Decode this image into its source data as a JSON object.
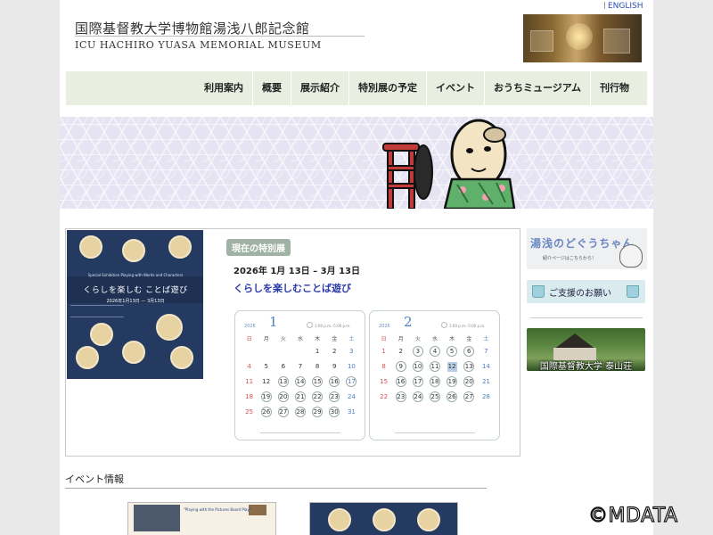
{
  "header": {
    "title_ja": "国際基督教大学博物館湯浅八郎記念館",
    "title_en": "ICU HACHIRO YUASA MEMORIAL MUSEUM",
    "english_link": "ENGLISH"
  },
  "nav": {
    "items": [
      {
        "label": "利用案内"
      },
      {
        "label": "概要"
      },
      {
        "label": "展示紹介"
      },
      {
        "label": "特別展の予定"
      },
      {
        "label": "イベント"
      },
      {
        "label": "おうちミュージアム"
      },
      {
        "label": "刊行物"
      }
    ]
  },
  "exhibition": {
    "badge": "現在の特別展",
    "dates": "2026年 1月 13日 – 3月 13日",
    "title": "くらしを楽しむことば遊び",
    "poster": {
      "subtitle": "Special Exhibition  Playing with Words and Characters",
      "title": "くらしを楽しむ ことば遊び",
      "dates": "2026年1月13日 — 3月13日"
    }
  },
  "calendars": [
    {
      "year": "2026",
      "month": "1",
      "legend": "1:00 p.m.–5:00 p.m.",
      "weekdays": [
        "日 SUN",
        "月 MON",
        "火 TUE",
        "水 WED",
        "木 THU",
        "金 FRI",
        "土 SAT"
      ],
      "days": [
        [
          "",
          "",
          "",
          "",
          "1",
          "2",
          "3"
        ],
        [
          "4",
          "5",
          "6",
          "7",
          "8",
          "9",
          "10"
        ],
        [
          "11",
          "12",
          "13",
          "14",
          "15",
          "16",
          "17"
        ],
        [
          "18",
          "19",
          "20",
          "21",
          "22",
          "23",
          "24"
        ],
        [
          "25",
          "26",
          "27",
          "28",
          "29",
          "30",
          "31"
        ]
      ]
    },
    {
      "year": "2026",
      "month": "2",
      "legend": "1:00 p.m.–5:00 p.m.",
      "weekdays": [
        "日 SUN",
        "月 MON",
        "火 TUE",
        "水 WED",
        "木 THU",
        "金 FRI",
        "土 SAT"
      ],
      "days": [
        [
          "1",
          "2",
          "3",
          "4",
          "5",
          "6",
          "7"
        ],
        [
          "8",
          "9",
          "10",
          "11",
          "12",
          "13",
          "14"
        ],
        [
          "15",
          "16",
          "17",
          "18",
          "19",
          "20",
          "21"
        ],
        [
          "22",
          "23",
          "24",
          "25",
          "26",
          "27",
          "28"
        ]
      ]
    }
  ],
  "sidebar": {
    "mascot_title": "湯浅のどぐうちゃん",
    "mascot_sub": "紹介ページはこちらから！",
    "support": "ご支援のお願い",
    "house": "国際基督教大学 泰山荘"
  },
  "events": {
    "heading": "イベント情報",
    "thumb1_text": "\"Playing with the Pictures Board Play\""
  },
  "watermark": "©MDATA"
}
